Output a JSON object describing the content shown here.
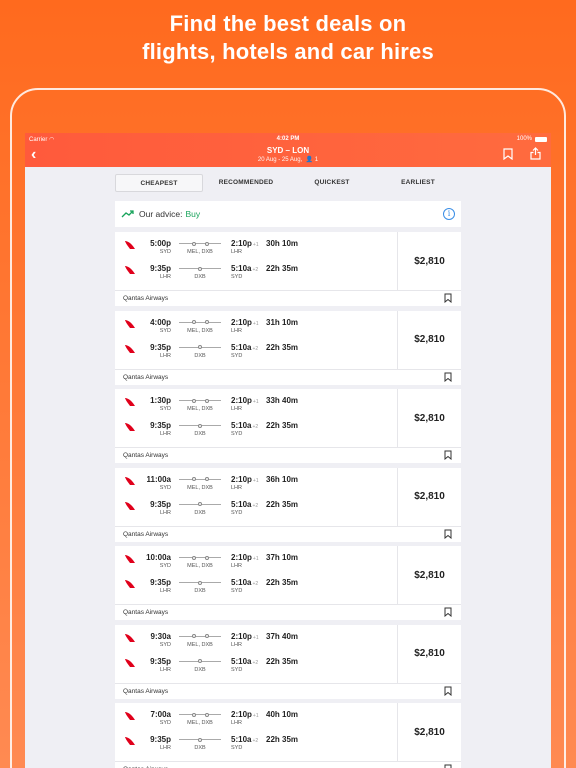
{
  "promo": {
    "line1": "Find the best deals on",
    "line2": "flights, hotels and car hires"
  },
  "statusbar": {
    "carrier": "Carrier",
    "time": "4:02 PM",
    "battery": "100%"
  },
  "navbar": {
    "title": "SYD – LON",
    "subtitle": "20 Aug - 25 Aug,",
    "passengers": "1"
  },
  "tabs": [
    {
      "label": "CHEAPEST",
      "active": true
    },
    {
      "label": "RECOMMENDED",
      "active": false
    },
    {
      "label": "QUICKEST",
      "active": false
    },
    {
      "label": "EARLIEST",
      "active": false
    }
  ],
  "advice": {
    "label": "Our advice:",
    "value": "Buy"
  },
  "colors": {
    "accent": "#ff5a3c",
    "advice_green": "#17a35a",
    "info_blue": "#3a8ee6"
  },
  "results": [
    {
      "price": "$2,810",
      "airline": "Qantas Airways",
      "out": {
        "dep": "5:00p",
        "dep_code": "SYD",
        "stops": "MEL, DXB",
        "arr": "2:10p",
        "plus": "+1",
        "arr_code": "LHR",
        "duration": "30h 10m"
      },
      "ret": {
        "dep": "9:35p",
        "dep_code": "LHR",
        "stops": "DXB",
        "arr": "5:10a",
        "plus": "+2",
        "arr_code": "SYD",
        "duration": "22h 35m"
      }
    },
    {
      "price": "$2,810",
      "airline": "Qantas Airways",
      "out": {
        "dep": "4:00p",
        "dep_code": "SYD",
        "stops": "MEL, DXB",
        "arr": "2:10p",
        "plus": "+1",
        "arr_code": "LHR",
        "duration": "31h 10m"
      },
      "ret": {
        "dep": "9:35p",
        "dep_code": "LHR",
        "stops": "DXB",
        "arr": "5:10a",
        "plus": "+2",
        "arr_code": "SYD",
        "duration": "22h 35m"
      }
    },
    {
      "price": "$2,810",
      "airline": "Qantas Airways",
      "out": {
        "dep": "1:30p",
        "dep_code": "SYD",
        "stops": "MEL, DXB",
        "arr": "2:10p",
        "plus": "+1",
        "arr_code": "LHR",
        "duration": "33h 40m"
      },
      "ret": {
        "dep": "9:35p",
        "dep_code": "LHR",
        "stops": "DXB",
        "arr": "5:10a",
        "plus": "+2",
        "arr_code": "SYD",
        "duration": "22h 35m"
      }
    },
    {
      "price": "$2,810",
      "airline": "Qantas Airways",
      "out": {
        "dep": "11:00a",
        "dep_code": "SYD",
        "stops": "MEL, DXB",
        "arr": "2:10p",
        "plus": "+1",
        "arr_code": "LHR",
        "duration": "36h 10m"
      },
      "ret": {
        "dep": "9:35p",
        "dep_code": "LHR",
        "stops": "DXB",
        "arr": "5:10a",
        "plus": "+2",
        "arr_code": "SYD",
        "duration": "22h 35m"
      }
    },
    {
      "price": "$2,810",
      "airline": "Qantas Airways",
      "out": {
        "dep": "10:00a",
        "dep_code": "SYD",
        "stops": "MEL, DXB",
        "arr": "2:10p",
        "plus": "+1",
        "arr_code": "LHR",
        "duration": "37h 10m"
      },
      "ret": {
        "dep": "9:35p",
        "dep_code": "LHR",
        "stops": "DXB",
        "arr": "5:10a",
        "plus": "+2",
        "arr_code": "SYD",
        "duration": "22h 35m"
      }
    },
    {
      "price": "$2,810",
      "airline": "Qantas Airways",
      "out": {
        "dep": "9:30a",
        "dep_code": "SYD",
        "stops": "MEL, DXB",
        "arr": "2:10p",
        "plus": "+1",
        "arr_code": "LHR",
        "duration": "37h 40m"
      },
      "ret": {
        "dep": "9:35p",
        "dep_code": "LHR",
        "stops": "DXB",
        "arr": "5:10a",
        "plus": "+2",
        "arr_code": "SYD",
        "duration": "22h 35m"
      }
    },
    {
      "price": "$2,810",
      "airline": "Qantas Airways",
      "out": {
        "dep": "7:00a",
        "dep_code": "SYD",
        "stops": "MEL, DXB",
        "arr": "2:10p",
        "plus": "+1",
        "arr_code": "LHR",
        "duration": "40h 10m"
      },
      "ret": {
        "dep": "9:35p",
        "dep_code": "LHR",
        "stops": "DXB",
        "arr": "5:10a",
        "plus": "+2",
        "arr_code": "SYD",
        "duration": "22h 35m"
      }
    }
  ]
}
